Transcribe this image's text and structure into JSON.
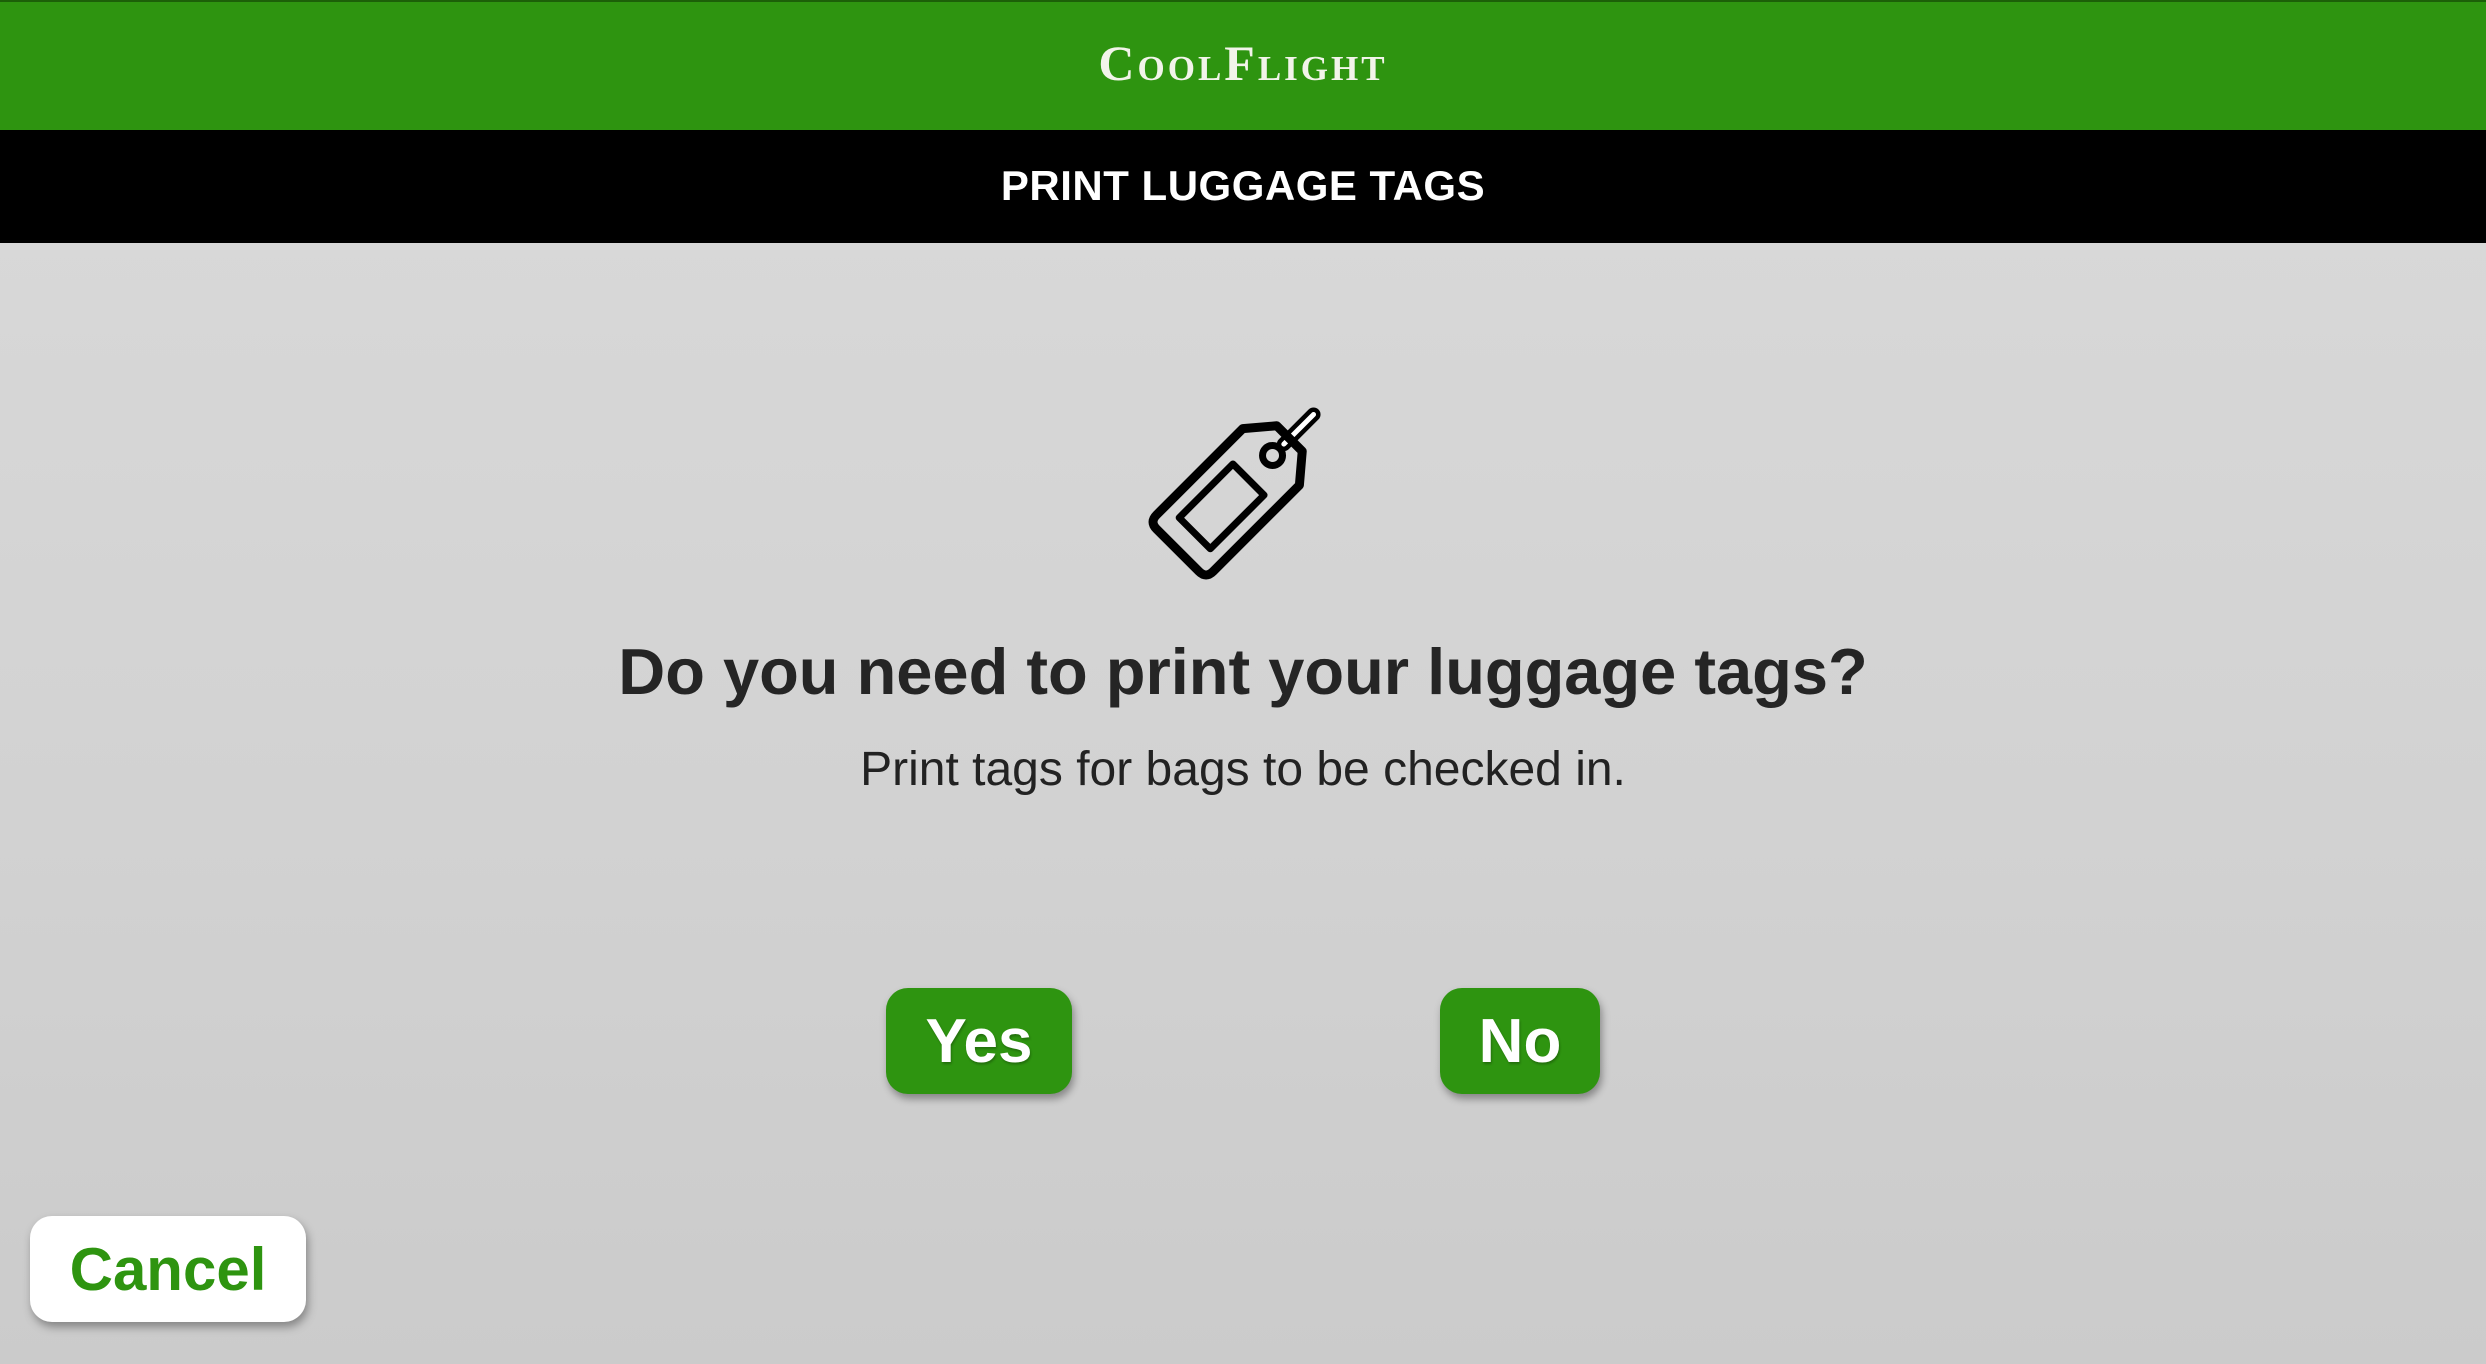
{
  "header": {
    "brand": "CoolFlight",
    "title": "PRINT LUGGAGE TAGS"
  },
  "main": {
    "icon": "luggage-tag-icon",
    "question": "Do you need to print your luggage tags?",
    "subtitle": "Print tags for bags to be checked in.",
    "yes_label": "Yes",
    "no_label": "No"
  },
  "footer": {
    "cancel_label": "Cancel"
  },
  "colors": {
    "brand_green": "#2e9410",
    "title_bar": "#000000",
    "background": "#d4d4d4"
  }
}
